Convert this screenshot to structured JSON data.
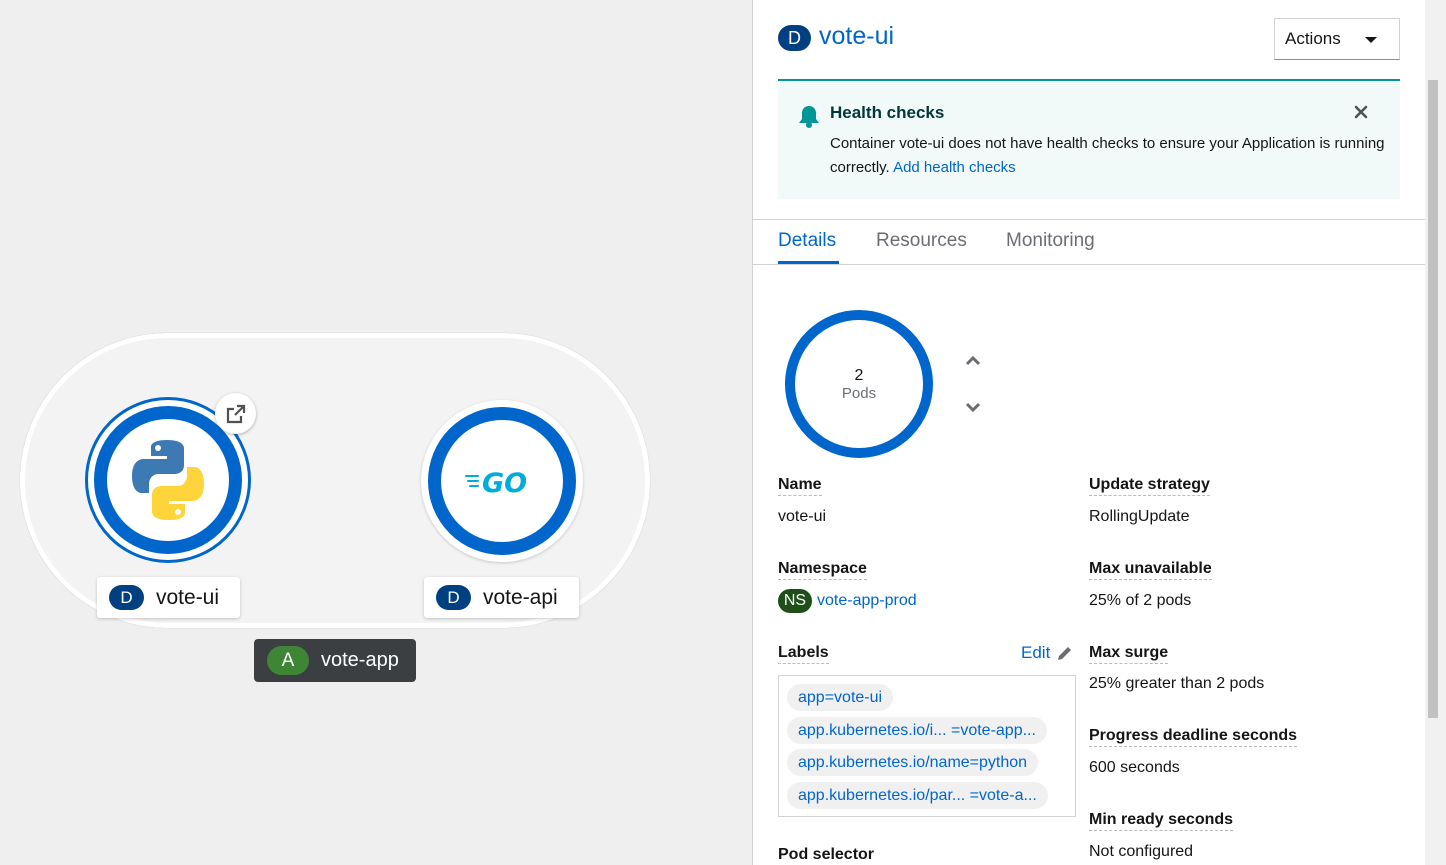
{
  "topology": {
    "nodes": [
      {
        "kind": "D",
        "name": "vote-ui",
        "runtime_icon": "python-icon"
      },
      {
        "kind": "D",
        "name": "vote-api",
        "runtime_icon": "go-icon"
      }
    ],
    "application": {
      "kind": "A",
      "name": "vote-app"
    }
  },
  "panel": {
    "kind": "D",
    "title": "vote-ui",
    "actions_label": "Actions",
    "alert": {
      "title": "Health checks",
      "body": "Container vote-ui does not have health checks to ensure your Application is running correctly.",
      "link": "Add health checks"
    },
    "tabs": [
      "Details",
      "Resources",
      "Monitoring"
    ],
    "pods": {
      "count": "2",
      "unit": "Pods"
    },
    "details": {
      "name_label": "Name",
      "name_value": "vote-ui",
      "namespace_label": "Namespace",
      "namespace_badge": "NS",
      "namespace_value": "vote-app-prod",
      "labels_label": "Labels",
      "edit_label": "Edit",
      "labels": [
        "app=vote-ui",
        "app.kubernetes.io/i... =vote-app...",
        "app.kubernetes.io/name=python",
        "app.kubernetes.io/par... =vote-a..."
      ],
      "pod_selector_label": "Pod selector",
      "update_strategy_label": "Update strategy",
      "update_strategy_value": "RollingUpdate",
      "max_unavailable_label": "Max unavailable",
      "max_unavailable_value": "25% of 2 pods",
      "max_surge_label": "Max surge",
      "max_surge_value": "25% greater than 2 pods",
      "progress_deadline_label": "Progress deadline seconds",
      "progress_deadline_value": "600 seconds",
      "min_ready_label": "Min ready seconds",
      "min_ready_value": "Not configured"
    }
  },
  "colors": {
    "accent": "#0066cc",
    "teal": "#009596",
    "deployment_badge": "#004080",
    "app_badge": "#3e8635",
    "namespace_badge": "#1e4f18"
  }
}
